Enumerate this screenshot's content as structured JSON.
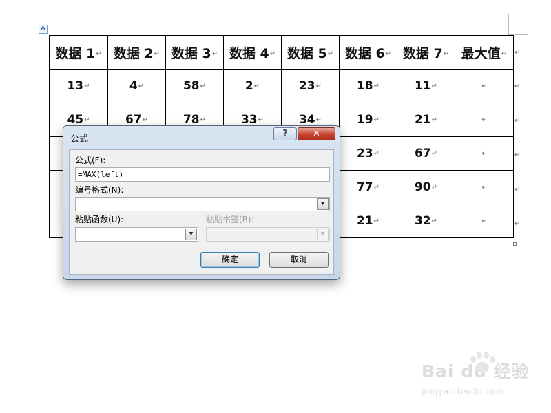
{
  "table": {
    "headers": [
      "数据 1",
      "数据 2",
      "数据 3",
      "数据 4",
      "数据 5",
      "数据 6",
      "数据 7",
      "最大值"
    ],
    "rows": [
      [
        "13",
        "4",
        "58",
        "2",
        "23",
        "18",
        "11",
        ""
      ],
      [
        "45",
        "67",
        "78",
        "33",
        "34",
        "19",
        "21",
        ""
      ],
      [
        "",
        "",
        "",
        "",
        "",
        "23",
        "67",
        ""
      ],
      [
        "",
        "",
        "",
        "",
        "",
        "77",
        "90",
        ""
      ],
      [
        "",
        "",
        "",
        "",
        "",
        "21",
        "32",
        ""
      ]
    ],
    "paragraph_mark": "↵",
    "move_handle_icon": "move-cross-icon",
    "header_label_1": "数据 1",
    "header_label_2": "数据 2",
    "header_label_3": "数据 3",
    "header_label_4": "数据 4",
    "header_label_5": "数据 5",
    "header_label_6": "数据 6",
    "header_label_7": "数据 7",
    "header_label_8": "最大值"
  },
  "dialog": {
    "title": "公式",
    "help_button": "?",
    "close_button": "✕",
    "formula_label": "公式(F):",
    "formula_value": "=MAX(left)",
    "number_format_label": "编号格式(N):",
    "number_format_value": "",
    "paste_function_label": "粘贴函数(U):",
    "paste_function_value": "",
    "paste_bookmark_label": "粘贴书签(B):",
    "paste_bookmark_value": "",
    "ok_button": "确定",
    "cancel_button": "取消"
  },
  "watermark": {
    "logo_text": "Bai du 经验",
    "url": "jingyan.baidu.com"
  }
}
